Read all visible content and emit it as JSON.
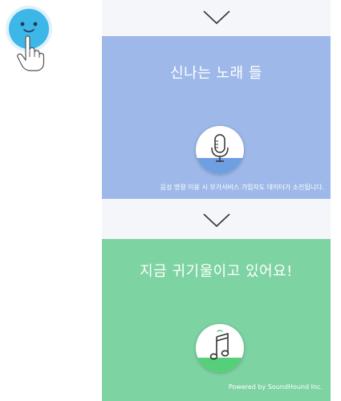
{
  "top_panel": {
    "title": "신나는 노래 들",
    "button_icon": "microphone-icon",
    "footnote": "음성 명령 이용 시 부가서비스 가입자도 데이터가 소진됩니다.",
    "color": "#9eb9e9"
  },
  "bottom_panel": {
    "title": "지금 귀기울이고 있어요!",
    "button_icon": "music-note-icon",
    "footnote": "Powered by SoundHound Inc.",
    "color": "#7dd3a1"
  },
  "mascot": {
    "icon": "smiley-face-icon",
    "gesture_icon": "tap-finger-icon",
    "color": "#3db6e8"
  },
  "step_arrows": {
    "icon": "chevron-down-icon"
  }
}
